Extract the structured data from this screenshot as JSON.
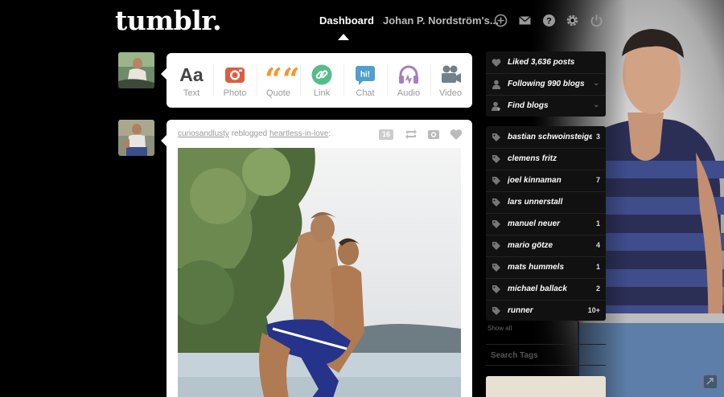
{
  "header": {
    "logo": "tumblr.",
    "nav_dashboard": "Dashboard",
    "nav_user": "Johan P. Nordström's...",
    "icons": [
      "new-post-icon",
      "inbox-icon",
      "help-icon",
      "settings-icon",
      "power-icon"
    ]
  },
  "composer": {
    "types": [
      {
        "label": "Text",
        "icon": "text-icon",
        "glyph": "Aa",
        "color": "#444444"
      },
      {
        "label": "Photo",
        "icon": "camera-icon",
        "color": "#d95e40"
      },
      {
        "label": "Quote",
        "icon": "quote-icon",
        "glyph": "““",
        "color": "#f2992e"
      },
      {
        "label": "Link",
        "icon": "link-icon",
        "color": "#56bc8a"
      },
      {
        "label": "Chat",
        "icon": "chat-icon",
        "glyph": "hi!",
        "color": "#529ecc"
      },
      {
        "label": "Audio",
        "icon": "headphones-icon",
        "color": "#a77dc2"
      },
      {
        "label": "Video",
        "icon": "video-camera-icon",
        "color": "#748089"
      }
    ]
  },
  "post": {
    "reblogger": "curiosandlusty",
    "reblogged_text": "reblogged",
    "source": "heartless-in-love",
    "source_suffix": ":",
    "notes": "16"
  },
  "sidebar": {
    "stats": [
      {
        "label": "Liked 3,636 posts",
        "icon": "heart-icon"
      },
      {
        "label": "Following 990 blogs",
        "icon": "person-icon"
      },
      {
        "label": "Find blogs",
        "icon": "add-person-icon"
      }
    ],
    "tags": [
      {
        "label": "bastian schwoinsteiger",
        "count": "3"
      },
      {
        "label": "clemens fritz",
        "count": ""
      },
      {
        "label": "joel kinnaman",
        "count": "7"
      },
      {
        "label": "lars unnerstall",
        "count": ""
      },
      {
        "label": "manuel neuer",
        "count": "1"
      },
      {
        "label": "mario götze",
        "count": "4"
      },
      {
        "label": "mats hummels",
        "count": "1"
      },
      {
        "label": "michael ballack",
        "count": "2"
      },
      {
        "label": "runner",
        "count": "10+"
      }
    ],
    "show_all": "Show all",
    "search_placeholder": "Search Tags"
  },
  "colors": {
    "background": "#000000",
    "panel": "#111111",
    "card": "#ffffff"
  }
}
